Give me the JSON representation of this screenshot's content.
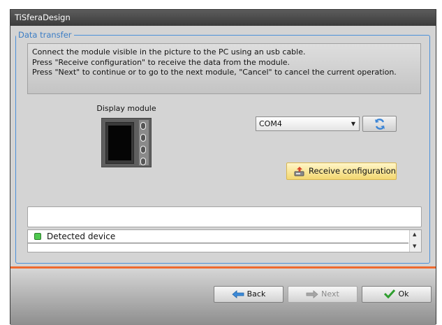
{
  "window": {
    "title": "TiSferaDesign"
  },
  "group": {
    "legend": "Data transfer"
  },
  "info": {
    "line1": "Connect the module visible in the picture to the PC using an usb cable.",
    "line2": "Press \"Receive configuration\" to receive the data from the module.",
    "line3": "Press \"Next\" to continue or to go to the next module, \"Cancel\" to cancel the current operation."
  },
  "module": {
    "label": "Display module"
  },
  "port": {
    "selected": "COM4"
  },
  "receive": {
    "label": "Receive configuration"
  },
  "status_field": {
    "value": ""
  },
  "devices": {
    "items": [
      {
        "label": "Detected device",
        "status_color": "#4ec94e"
      }
    ]
  },
  "buttons": {
    "back": "Back",
    "next": "Next",
    "ok": "Ok"
  },
  "colors": {
    "accent": "#ee6a2f",
    "group_border": "#4a90d9",
    "legend_text": "#3b7dc5"
  },
  "icons": {
    "refresh": "refresh-icon",
    "receive": "download-device-icon",
    "back": "arrow-left-icon",
    "next": "arrow-right-icon",
    "ok": "checkmark-icon"
  }
}
